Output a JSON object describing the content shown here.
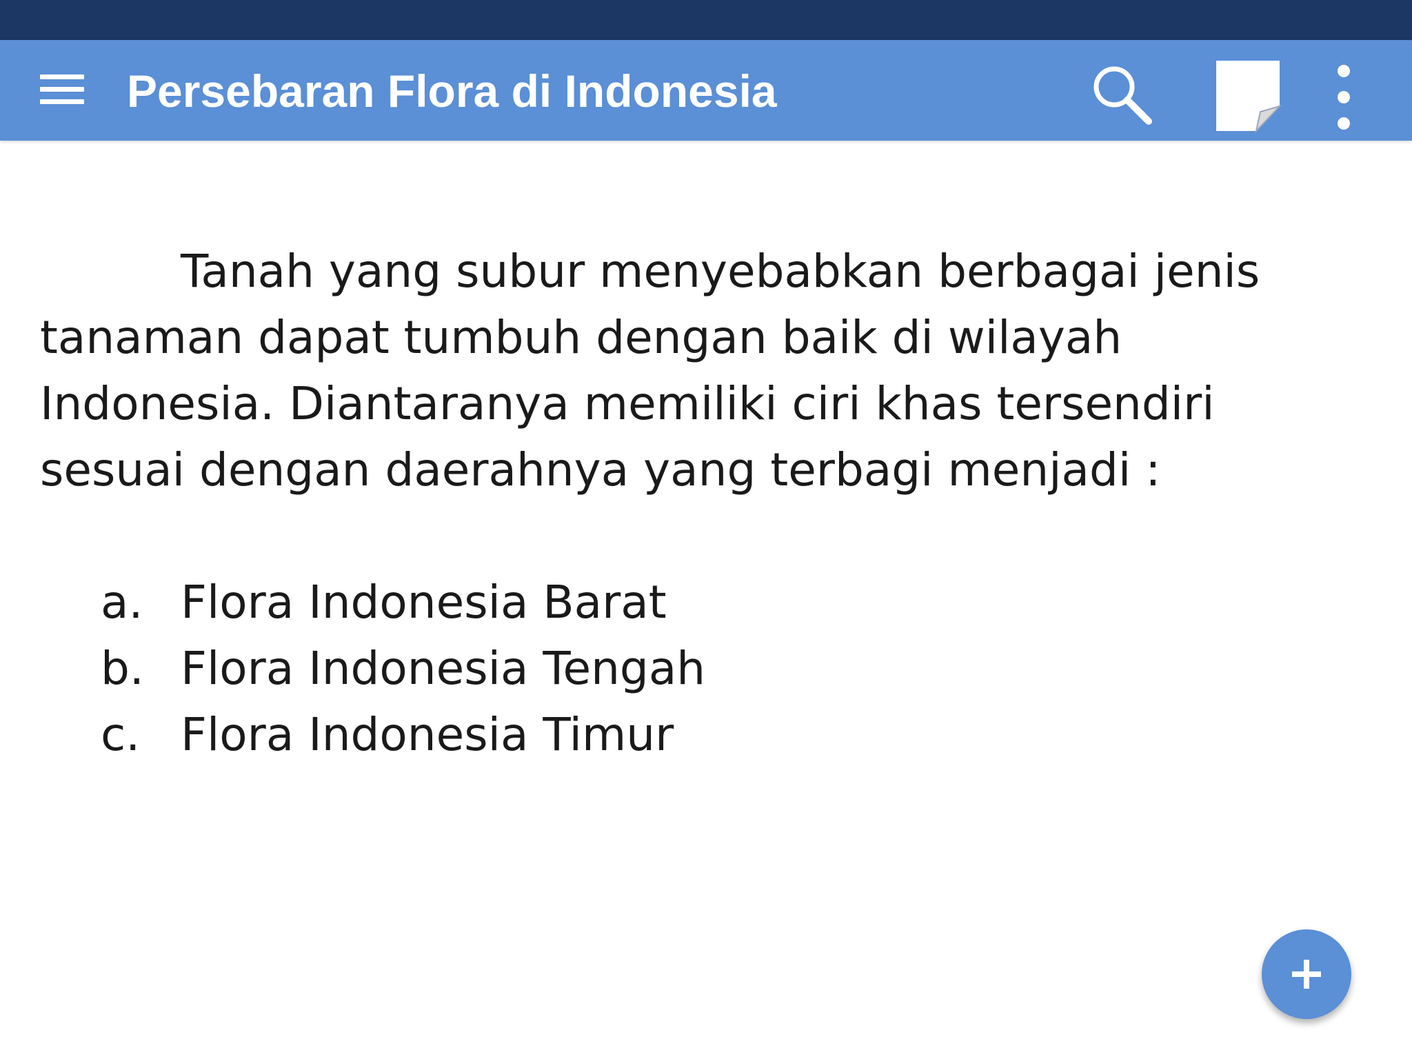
{
  "app_bar": {
    "title": "Persebaran Flora di Indonesia",
    "icons": [
      "menu-icon",
      "search-icon",
      "note-icon",
      "more-vert-icon"
    ]
  },
  "content": {
    "paragraph": "Tanah yang subur menyebabkan berbagai jenis tanaman dapat tumbuh dengan baik di wilayah Indonesia. Diantaranya memiliki ciri khas tersendiri sesuai dengan daerahnya yang terbagi menjadi :",
    "list": [
      {
        "marker": "a.",
        "text": "Flora Indonesia Barat"
      },
      {
        "marker": "b.",
        "text": "Flora Indonesia Tengah"
      },
      {
        "marker": "c.",
        "text": "Flora Indonesia Timur"
      }
    ]
  },
  "fab": {
    "icon": "plus-icon"
  },
  "colors": {
    "status_bar": "#1c3764",
    "app_bar": "#5b8fd6",
    "fab": "#5b8fd6",
    "text": "#1a1a1a"
  }
}
